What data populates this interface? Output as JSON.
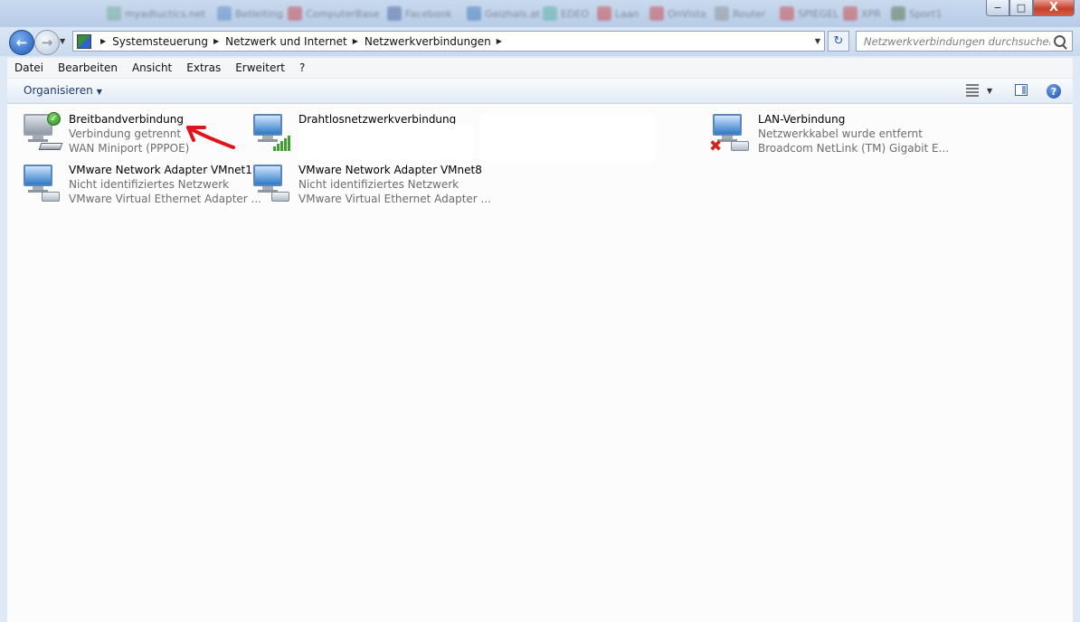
{
  "window": {
    "controls": {
      "minimize": "−",
      "maximize": "□",
      "close": "X"
    },
    "background_tabs": [
      {
        "label": "myadtuctics.net",
        "color": "#6a8"
      },
      {
        "label": "Betleiting",
        "color": "#4a7fc1"
      },
      {
        "label": "ComputerBase",
        "color": "#c33"
      },
      {
        "label": "Facebook",
        "color": "#3b5998"
      },
      {
        "label": "Geizhals.at",
        "color": "#2d6fb4"
      },
      {
        "label": "EDEO",
        "color": "#4a9"
      },
      {
        "label": "Laan",
        "color": "#c33"
      },
      {
        "label": "OnVista",
        "color": "#c33"
      },
      {
        "label": "Router",
        "color": "#888"
      },
      {
        "label": "SPIEGEL",
        "color": "#c33"
      },
      {
        "label": "XPR",
        "color": "#c33"
      },
      {
        "label": "Sport1",
        "color": "#463"
      }
    ]
  },
  "address": {
    "breadcrumbs": [
      "Systemsteuerung",
      "Netzwerk und Internet",
      "Netzwerkverbindungen"
    ],
    "search_placeholder": "Netzwerkverbindungen durchsuchen"
  },
  "menu": [
    "Datei",
    "Bearbeiten",
    "Ansicht",
    "Extras",
    "Erweitert",
    "?"
  ],
  "toolbar": {
    "organize_label": "Organisieren"
  },
  "connections": [
    {
      "name": "Breitbandverbindung",
      "status": "Verbindung getrennt",
      "device": "WAN Miniport (PPPOE)",
      "icon": "broadband-icon",
      "badge": "connected-check-icon"
    },
    {
      "name": "Drahtlosnetzwerkverbindung",
      "status": "",
      "device": "",
      "icon": "wireless-icon",
      "badge": "signal-bars-icon"
    },
    {
      "name": "LAN-Verbindung",
      "status": "Netzwerkkabel wurde entfernt",
      "device": "Broadcom NetLink (TM) Gigabit E...",
      "icon": "lan-icon",
      "badge": "disconnected-x-icon"
    },
    {
      "name": "VMware Network Adapter VMnet1",
      "status": "Nicht identifiziertes Netzwerk",
      "device": "VMware Virtual Ethernet Adapter ...",
      "icon": "vmware-adapter-icon"
    },
    {
      "name": "VMware Network Adapter VMnet8",
      "status": "Nicht identifiziertes Netzwerk",
      "device": "VMware Virtual Ethernet Adapter ...",
      "icon": "vmware-adapter-icon"
    }
  ]
}
